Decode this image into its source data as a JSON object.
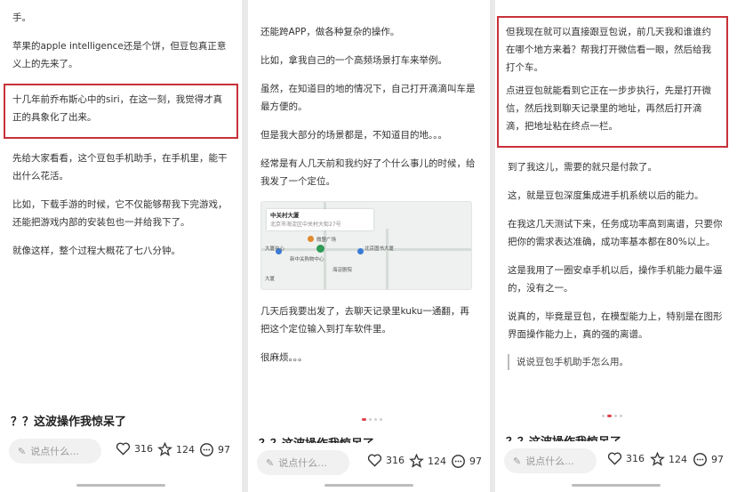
{
  "panels": [
    {
      "paragraphs": [
        "手。",
        "苹果的apple intelligence还是个饼，但豆包真正意义上的先来了。"
      ],
      "highlight": "十几年前乔布斯心中的siri，在这一刻，我觉得才真正的具象化了出来。",
      "paragraphs2": [
        "先给大家看看，这个豆包手机助手，在手机里，能干出什么花活。",
        "比如，下载手游的时候，它不仅能够帮我下完游戏，还能把游戏内部的安装包也一并给我下了。",
        "就像这样，整个过程大概花了七八分钟。"
      ],
      "post_title": "？？这波操作我惊呆了"
    },
    {
      "paragraphs": [
        "还能跨APP，做各种复杂的操作。",
        "比如，拿我自己的一个高频场景打车来举例。",
        "虽然，在知道目的地的情况下，自己打开滴滴叫车是最方便的。",
        "但是我大部分的场景都是，不知道目的地。。。",
        "经常是有人几天前和我约好了个什么事儿的时候，给我发了一个定位。"
      ],
      "map": {
        "place": "中关村大厦",
        "address": "北京市海淀区中关村大街27号",
        "labels": [
          "大厦中心",
          "新中关购物中心",
          "海淀剧院",
          "北京图书大厦",
          "大厦",
          "微盟广场"
        ]
      },
      "paragraphs2": [
        "几天后我要出发了，去聊天记录里kuku一通翻，再把这个定位输入到打车软件里。",
        "很麻烦。。。"
      ],
      "post_title": "？？这波操作我惊呆了"
    },
    {
      "highlight": [
        "但我现在就可以直接跟豆包说，前几天我和谁谁约在哪个地方来着？帮我打开微信看一眼，然后给我打个车。",
        "点进豆包就能看到它正在一步步执行，先是打开微信，然后找到聊天记录里的地址，再然后打开滴滴，把地址粘在终点一栏。"
      ],
      "paragraphs2": [
        "到了我这儿，需要的就只是付款了。",
        "这，就是豆包深度集成进手机系统以后的能力。",
        "在我这几天测试下来，任务成功率高到离谱，只要你把你的需求表达准确，成功率基本都在80%以上。",
        "这是我用了一圈安卓手机以后，操作手机能力最牛逼的，没有之一。",
        "说真的，毕竟是豆包，在模型能力上，特别是在图形界面操作能力上，真的强的离谱。"
      ],
      "quote": "说说豆包手机助手怎么用。",
      "post_title": "？？这波操作我惊呆了"
    }
  ],
  "bottom_bar": {
    "comment_placeholder": "说点什么...",
    "likes": "316",
    "favorites": "124",
    "comments": "97"
  },
  "colors": {
    "highlight_border": "#c8313a",
    "accent_dot": "#e0424b"
  }
}
